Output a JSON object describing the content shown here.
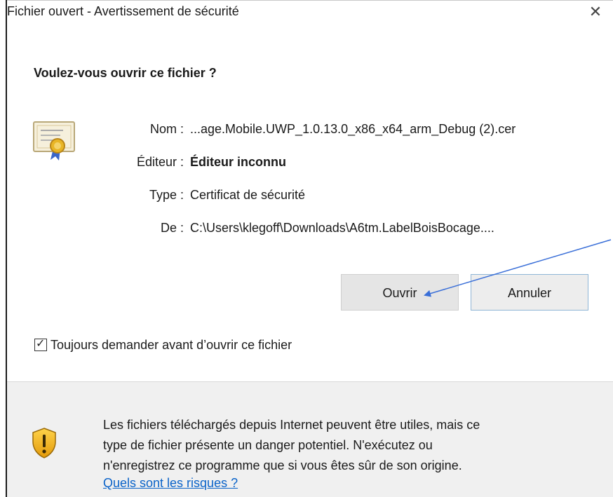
{
  "window": {
    "title": "Fichier ouvert - Avertissement de sécurité",
    "close_symbol": "✕"
  },
  "dialog": {
    "question": "Voulez-vous ouvrir ce fichier ?",
    "icon": "certificate-icon",
    "fields": {
      "name_label": "Nom :",
      "name_value": "...age.Mobile.UWP_1.0.13.0_x86_x64_arm_Debug (2).cer",
      "publisher_label": "Éditeur :",
      "publisher_value": "Éditeur inconnu",
      "type_label": "Type :",
      "type_value": "Certificat de sécurité",
      "from_label": "De :",
      "from_value": "C:\\Users\\klegoff\\Downloads\\A6tm.LabelBoisBocage...."
    },
    "buttons": {
      "open_label": "Ouvrir",
      "cancel_label": "Annuler"
    },
    "checkbox": {
      "label": "Toujours demander avant d’ouvrir ce fichier",
      "checked": true
    }
  },
  "footer": {
    "icon": "warning-shield-icon",
    "warning_line1": "Les fichiers téléchargés depuis Internet peuvent être utiles, mais ce",
    "warning_line2": "type de fichier présente un danger potentiel. N'exécutez ou",
    "warning_line3": "n'enregistrez ce programme que si vous êtes sûr de son origine.",
    "risk_link": "Quels sont les risques ?"
  },
  "colors": {
    "annotation_arrow": "#3a6fd8",
    "link": "#0a63c9",
    "cancel_border": "#8fb5d6"
  }
}
